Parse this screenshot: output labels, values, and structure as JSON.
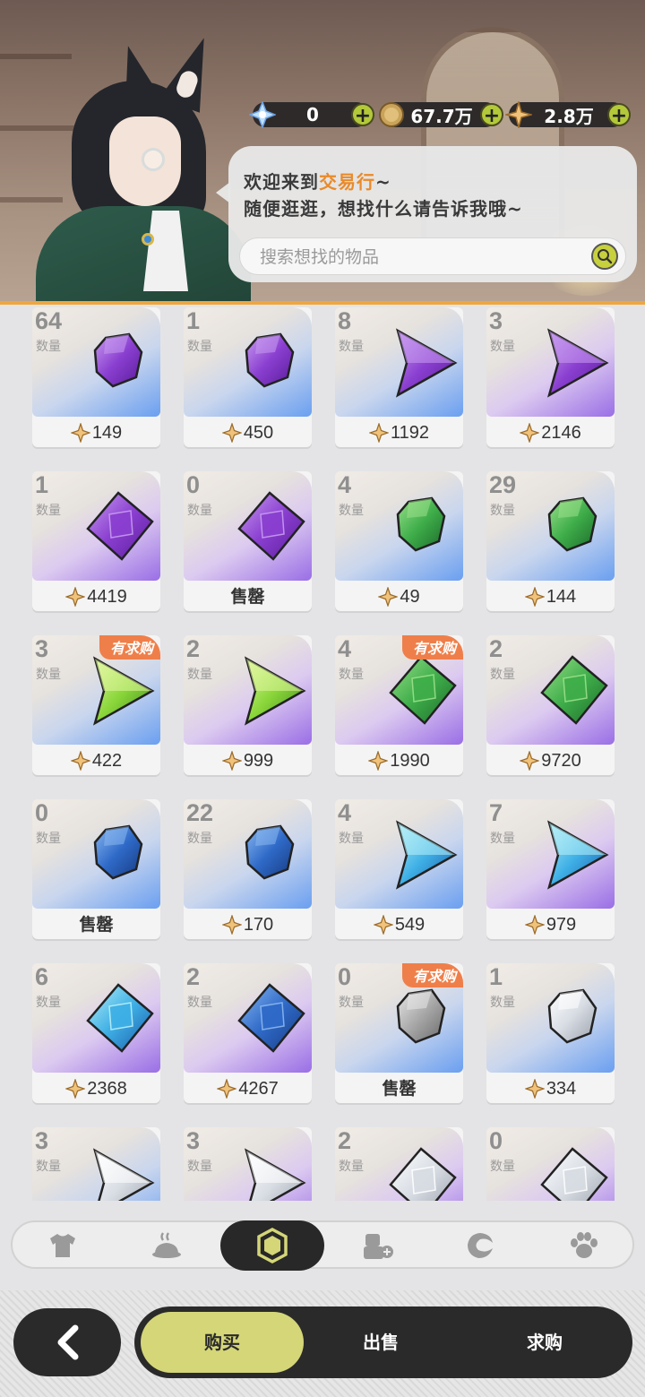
{
  "currencies": [
    {
      "icon": "crystal-icon",
      "value": "0"
    },
    {
      "icon": "coin-icon",
      "value": "67.7万"
    },
    {
      "icon": "star-shard-icon",
      "value": "2.8万"
    }
  ],
  "npc": {
    "greeting_prefix": "欢迎来到",
    "greeting_highlight": "交易行",
    "greeting_suffix": "~",
    "line2": "随便逛逛，想找什么请告诉我哦~"
  },
  "search": {
    "placeholder": "搜索想找的物品"
  },
  "labels": {
    "quantity": "数量",
    "sold_out": "售罄",
    "wanted": "有求购"
  },
  "items": [
    {
      "qty": "64",
      "price": "149",
      "shape": "rock",
      "color": "purple",
      "bg": "blue"
    },
    {
      "qty": "1",
      "price": "450",
      "shape": "rock",
      "color": "purple",
      "bg": "blue"
    },
    {
      "qty": "8",
      "price": "1192",
      "shape": "tri",
      "color": "purple",
      "bg": "blue"
    },
    {
      "qty": "3",
      "price": "2146",
      "shape": "tri",
      "color": "purple",
      "bg": "purple"
    },
    {
      "qty": "1",
      "price": "4419",
      "shape": "diamond",
      "color": "purple",
      "bg": "purple"
    },
    {
      "qty": "0",
      "price": "",
      "sold": true,
      "shape": "diamond",
      "color": "purple",
      "bg": "purple"
    },
    {
      "qty": "4",
      "price": "49",
      "shape": "rock",
      "color": "green",
      "bg": "blue"
    },
    {
      "qty": "29",
      "price": "144",
      "shape": "rock",
      "color": "green",
      "bg": "blue"
    },
    {
      "qty": "3",
      "price": "422",
      "shape": "tri",
      "color": "lime",
      "bg": "blue",
      "wanted": true
    },
    {
      "qty": "2",
      "price": "999",
      "shape": "tri",
      "color": "lime",
      "bg": "purple"
    },
    {
      "qty": "4",
      "price": "1990",
      "shape": "diamond",
      "color": "green",
      "bg": "purple",
      "wanted": true
    },
    {
      "qty": "2",
      "price": "9720",
      "shape": "diamond",
      "color": "green",
      "bg": "purple"
    },
    {
      "qty": "0",
      "price": "",
      "sold": true,
      "shape": "rock",
      "color": "blue",
      "bg": "blue"
    },
    {
      "qty": "22",
      "price": "170",
      "shape": "rock",
      "color": "blue",
      "bg": "blue"
    },
    {
      "qty": "4",
      "price": "549",
      "shape": "tri",
      "color": "cyan",
      "bg": "blue"
    },
    {
      "qty": "7",
      "price": "979",
      "shape": "tri",
      "color": "cyan",
      "bg": "purple"
    },
    {
      "qty": "6",
      "price": "2368",
      "shape": "diamond",
      "color": "cyan",
      "bg": "purple"
    },
    {
      "qty": "2",
      "price": "4267",
      "shape": "diamond",
      "color": "blue",
      "bg": "purple"
    },
    {
      "qty": "0",
      "price": "",
      "sold": true,
      "shape": "rock",
      "color": "gray",
      "bg": "blue",
      "wanted": true
    },
    {
      "qty": "1",
      "price": "334",
      "shape": "rock",
      "color": "white",
      "bg": "blue"
    },
    {
      "qty": "3",
      "price": "",
      "shape": "tri",
      "color": "white",
      "bg": "blue"
    },
    {
      "qty": "3",
      "price": "",
      "shape": "tri",
      "color": "white",
      "bg": "purple"
    },
    {
      "qty": "2",
      "price": "",
      "shape": "diamond",
      "color": "white",
      "bg": "purple"
    },
    {
      "qty": "0",
      "price": "",
      "shape": "diamond",
      "color": "white",
      "bg": "purple"
    }
  ],
  "categories": [
    {
      "icon": "shirt-icon",
      "active": false
    },
    {
      "icon": "food-icon",
      "active": false
    },
    {
      "icon": "gem-icon",
      "active": true
    },
    {
      "icon": "furniture-icon",
      "active": false
    },
    {
      "icon": "material-icon",
      "active": false
    },
    {
      "icon": "pet-paw-icon",
      "active": false
    }
  ],
  "tabs": {
    "buy": "购买",
    "sell": "出售",
    "request": "求购",
    "active": "buy"
  },
  "colors": {
    "accent_lime": "#d4d678",
    "wanted_badge": "#ef7f4a",
    "highlight_orange": "#e98a2a",
    "dark": "#2a2a2a"
  }
}
